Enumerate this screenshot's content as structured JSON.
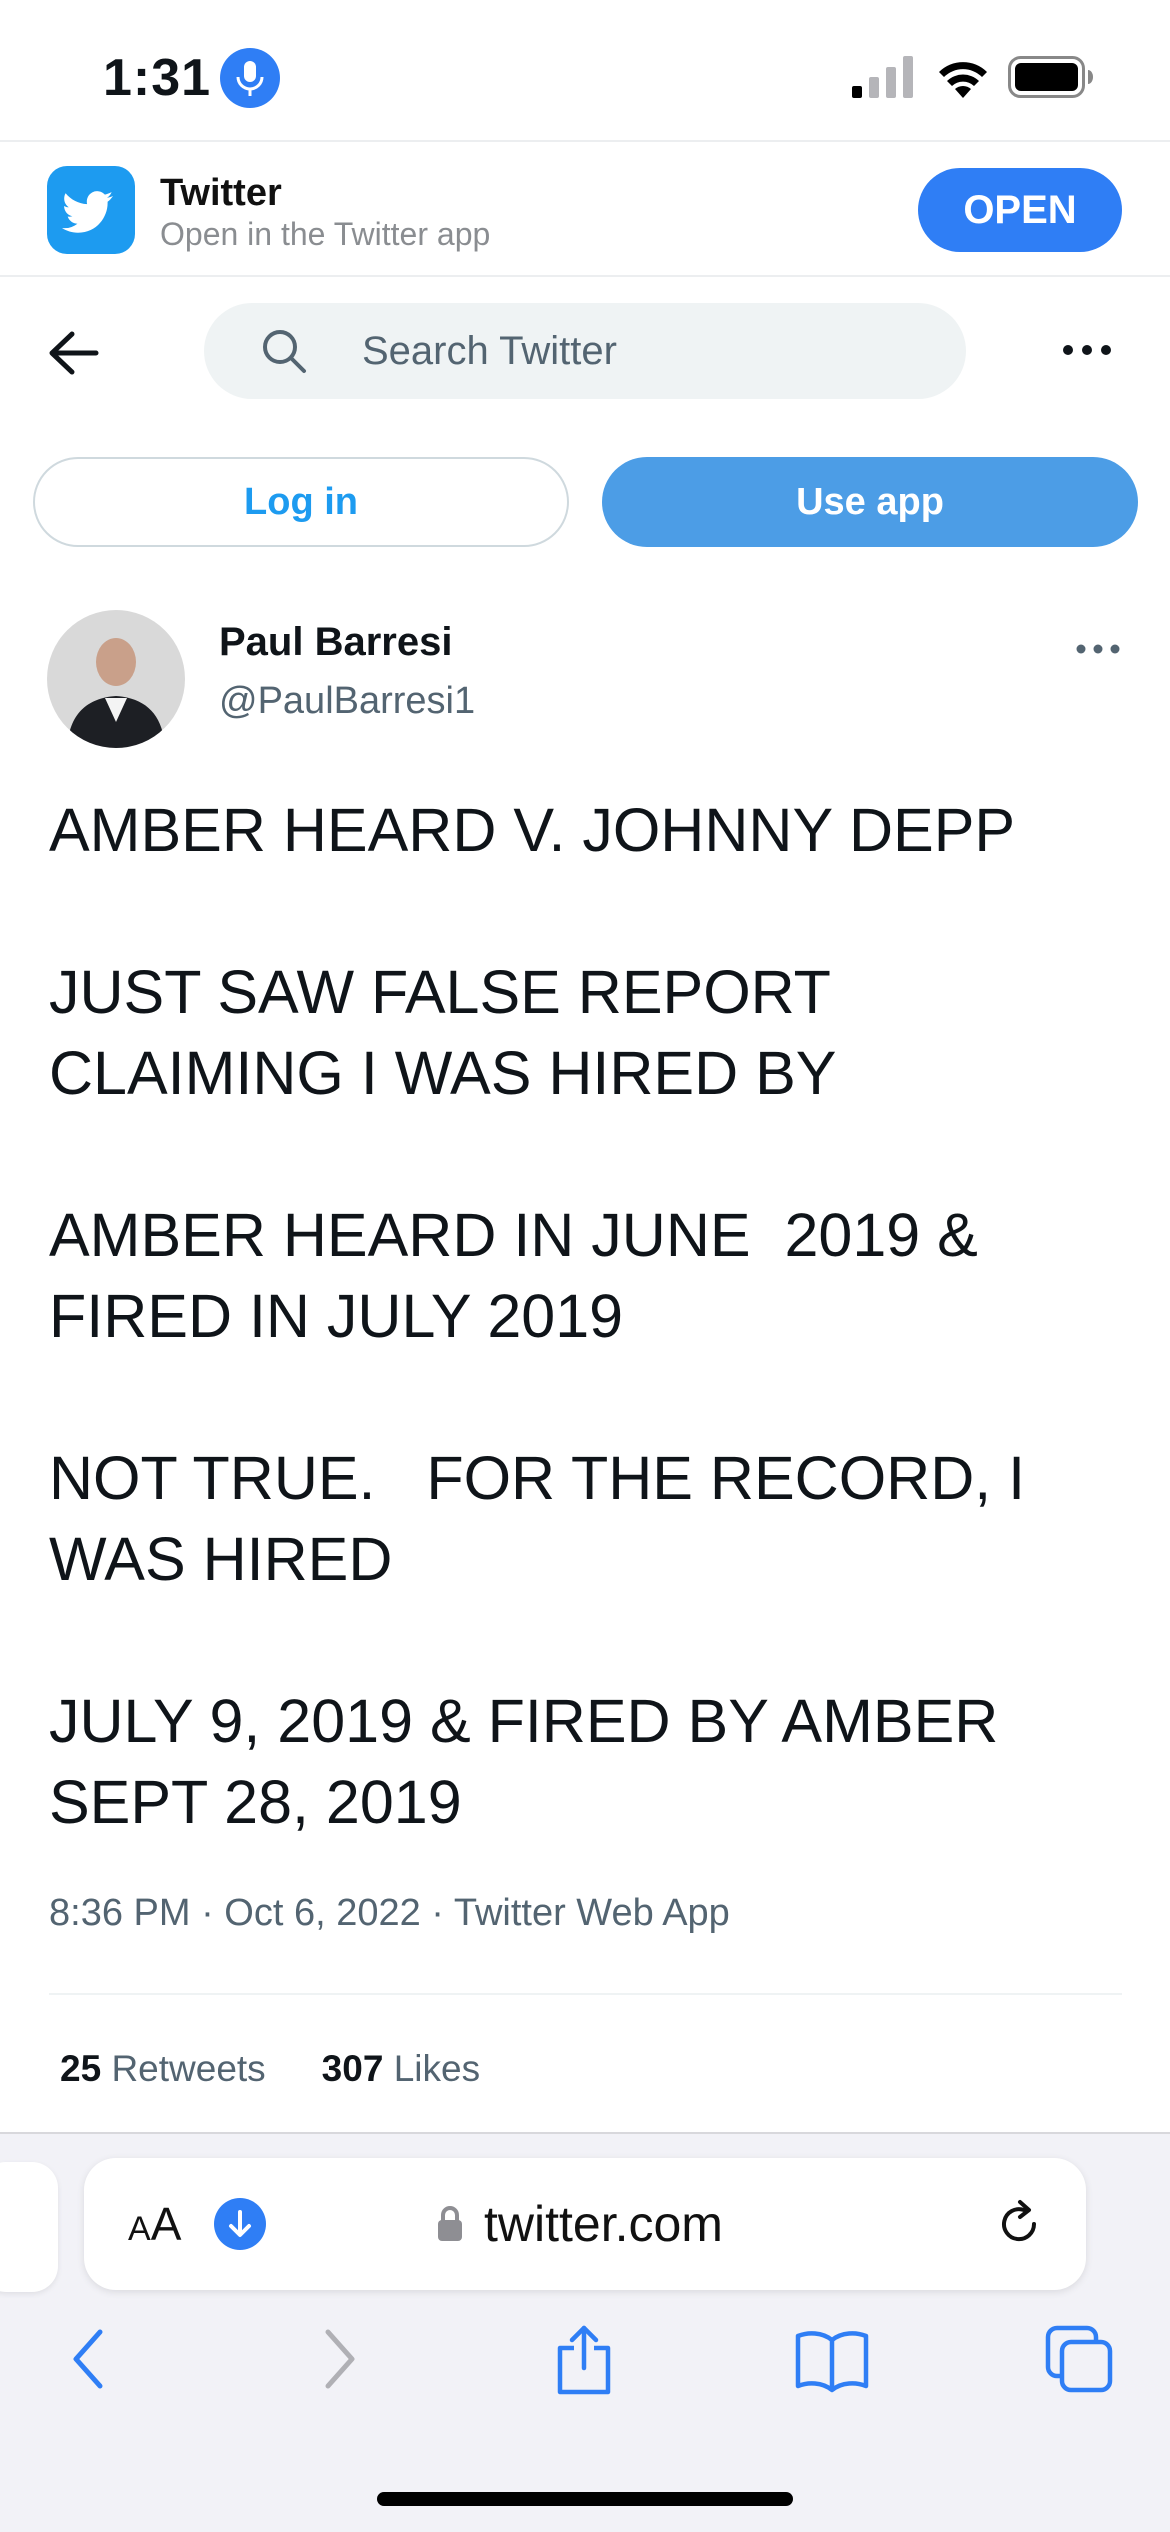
{
  "status_bar": {
    "time": "1:31",
    "accent_color": "#2f7ef5"
  },
  "app_banner": {
    "name": "Twitter",
    "subtitle": "Open in the Twitter app",
    "open_label": "OPEN",
    "brand_color": "#1d9bf0"
  },
  "nav": {
    "search_placeholder": "Search Twitter"
  },
  "auth": {
    "login_label": "Log in",
    "use_app_label": "Use app"
  },
  "tweet": {
    "author_name": "Paul Barresi",
    "author_handle": "@PaulBarresi1",
    "text": "AMBER HEARD V. JOHNNY DEPP\n\nJUST SAW FALSE REPORT\nCLAIMING I WAS HIRED BY\n\nAMBER HEARD IN JUNE  2019 &\nFIRED IN JULY 2019\n\nNOT TRUE.   FOR THE RECORD, I\nWAS HIRED\n\nJULY 9, 2019 & FIRED BY AMBER\nSEPT 28, 2019",
    "meta": "8:36 PM · Oct 6, 2022 · Twitter Web App",
    "retweets_count": "25",
    "retweets_label": "Retweets",
    "likes_count": "307",
    "likes_label": "Likes"
  },
  "safari": {
    "aa_small": "A",
    "aa_large": "A",
    "url": "twitter.com",
    "tint_color": "#2f7ef5"
  },
  "icons": [
    "mic-icon",
    "signal-icon",
    "wifi-icon",
    "battery-icon",
    "twitter-bird-icon",
    "back-arrow-icon",
    "search-icon",
    "more-icon",
    "download-icon",
    "lock-icon",
    "reload-icon",
    "chevron-left-icon",
    "chevron-right-icon",
    "share-icon",
    "bookmarks-icon",
    "tabs-icon"
  ]
}
